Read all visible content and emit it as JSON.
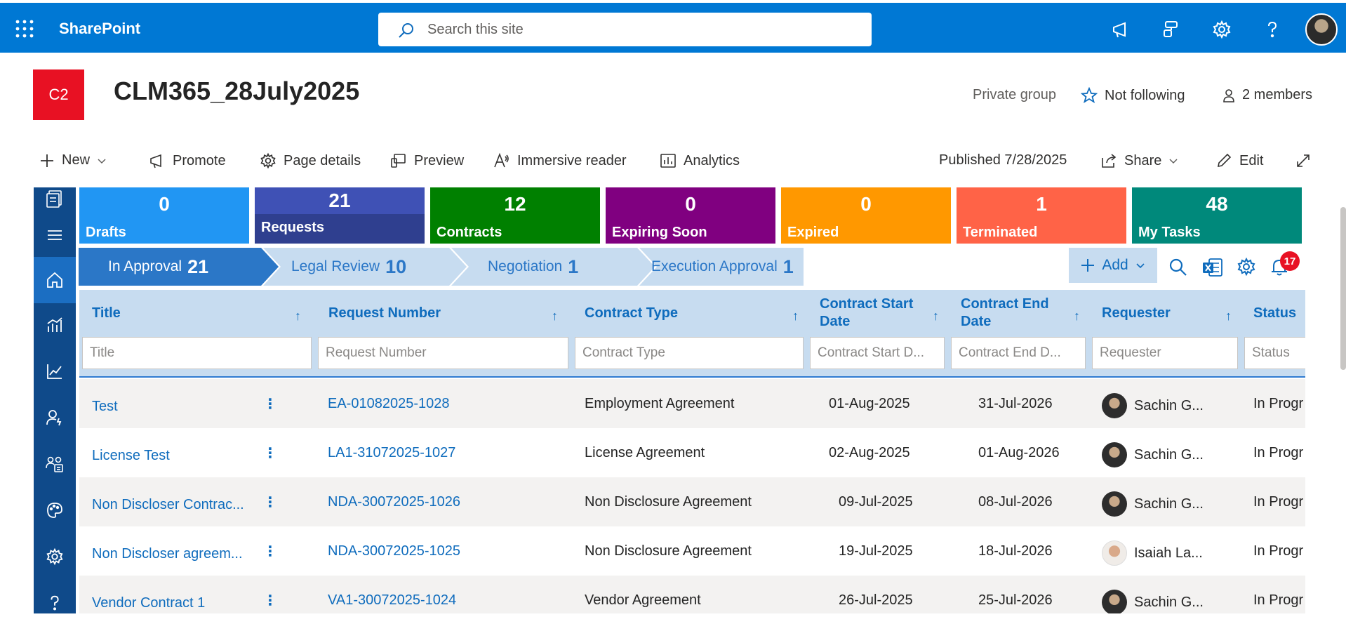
{
  "suite": {
    "brand": "SharePoint",
    "search_placeholder": "Search this site",
    "icons": [
      "waffle-icon",
      "search-icon",
      "megaphone-icon",
      "feedback-icon",
      "gear-icon",
      "help-icon"
    ]
  },
  "site": {
    "logo_text": "C2",
    "title": "CLM365_28July2025",
    "privacy": "Private group",
    "follow_label": "Not following",
    "members_label": "2 members",
    "logo_color": "#e81123"
  },
  "commandbar": {
    "new": "New",
    "promote": "Promote",
    "page_details": "Page details",
    "preview": "Preview",
    "immersive_reader": "Immersive reader",
    "analytics": "Analytics",
    "published": "Published 7/28/2025",
    "share": "Share",
    "edit": "Edit"
  },
  "tiles": [
    {
      "count": "0",
      "label": "Drafts",
      "color": "#2196f3"
    },
    {
      "count": "21",
      "label": "Requests",
      "color": "#3f51b5"
    },
    {
      "count": "12",
      "label": "Contracts",
      "color": "#008000"
    },
    {
      "count": "0",
      "label": "Expiring Soon",
      "color": "#800080"
    },
    {
      "count": "0",
      "label": "Expired",
      "color": "#ff9800"
    },
    {
      "count": "1",
      "label": "Terminated",
      "color": "#ff6347"
    },
    {
      "count": "48",
      "label": "My Tasks",
      "color": "#00897b"
    }
  ],
  "stages": [
    {
      "label": "In Approval",
      "count": "21",
      "active": true
    },
    {
      "label": "Legal Review",
      "count": "10",
      "active": false
    },
    {
      "label": "Negotiation",
      "count": "1",
      "active": false
    },
    {
      "label": "Execution Approval",
      "count": "1",
      "active": false
    }
  ],
  "toolbar": {
    "add_label": "Add",
    "notification_count": "17"
  },
  "grid": {
    "columns": [
      {
        "header": "Title",
        "filter_placeholder": "Title"
      },
      {
        "header": "Request Number",
        "filter_placeholder": "Request Number"
      },
      {
        "header": "Contract Type",
        "filter_placeholder": "Contract Type"
      },
      {
        "header": "Contract Start Date",
        "filter_placeholder": "Contract Start D..."
      },
      {
        "header": "Contract End Date",
        "filter_placeholder": "Contract End D..."
      },
      {
        "header": "Requester",
        "filter_placeholder": "Requester"
      },
      {
        "header": "Status",
        "filter_placeholder": "Status"
      }
    ],
    "rows": [
      {
        "title": "Test",
        "request_number": "EA-01082025-1028",
        "contract_type": "Employment Agreement",
        "start": "01-Aug-2025",
        "end": "31-Jul-2026",
        "requester": "Sachin G...",
        "status": "In Progr"
      },
      {
        "title": "License Test",
        "request_number": "LA1-31072025-1027",
        "contract_type": "License Agreement",
        "start": "02-Aug-2025",
        "end": "01-Aug-2026",
        "requester": "Sachin G...",
        "status": "In Progr"
      },
      {
        "title": "Non Discloser Contrac...",
        "request_number": "NDA-30072025-1026",
        "contract_type": "Non Disclosure Agreement",
        "start": "09-Jul-2025",
        "end": "08-Jul-2026",
        "requester": "Sachin G...",
        "status": "In Progr"
      },
      {
        "title": "Non Discloser agreem...",
        "request_number": "NDA-30072025-1025",
        "contract_type": "Non Disclosure Agreement",
        "start": "19-Jul-2025",
        "end": "18-Jul-2026",
        "requester": "Isaiah La...",
        "status": "In Progr"
      },
      {
        "title": "Vendor Contract 1",
        "request_number": "VA1-30072025-1024",
        "contract_type": "Vendor Agreement",
        "start": "26-Jul-2025",
        "end": "25-Jul-2026",
        "requester": "Sachin G...",
        "status": "In Progr"
      }
    ]
  }
}
